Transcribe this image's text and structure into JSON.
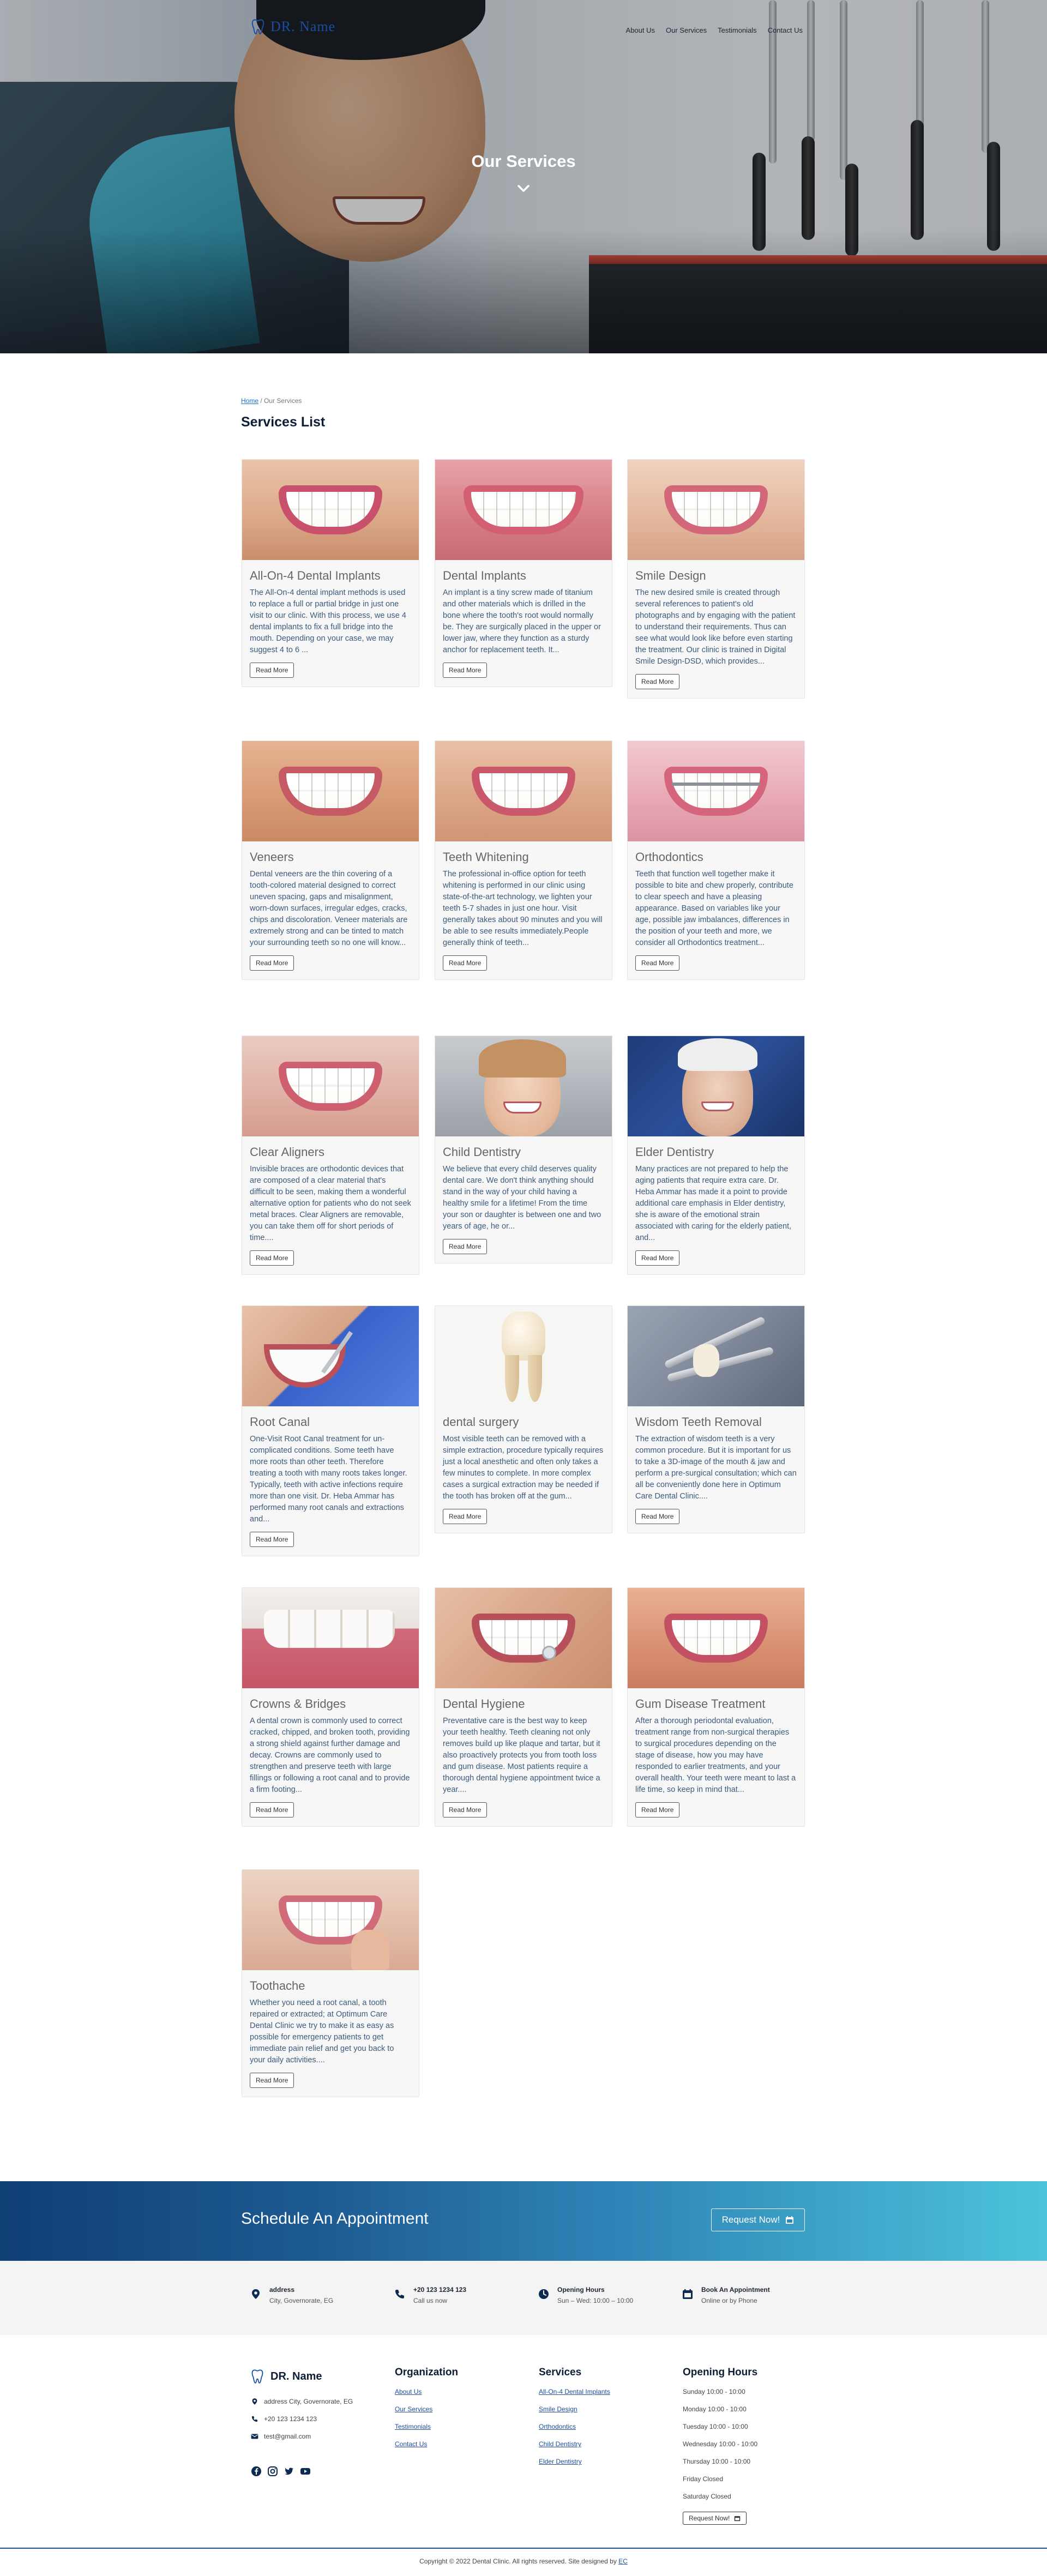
{
  "brand": {
    "name": "DR. Name"
  },
  "nav": {
    "items": [
      "About Us",
      "Our Services",
      "Testimonials",
      "Contact Us"
    ]
  },
  "hero": {
    "title": "Our Services"
  },
  "breadcrumb": {
    "home": "Home",
    "separator": "/",
    "current": "Our Services"
  },
  "section_title": "Services List",
  "read_more": "Read More",
  "services": [
    {
      "title": "All-On-4 Dental Implants",
      "text": "The All-On-4 dental implant methods is used to replace a full or partial bridge in just one visit to our clinic. With this process, we use 4 dental implants to fix a full bridge into the mouth. Depending on your case, we may suggest 4 to 6 ..."
    },
    {
      "title": "Dental Implants",
      "text": "An implant is a tiny screw made of titanium and other materials which is drilled in the bone where the tooth's root would normally be. They are surgically placed in the upper or lower jaw, where they function as a sturdy anchor for replacement teeth. It..."
    },
    {
      "title": "Smile Design",
      "text": "The new desired smile is created through several references to patient's old photographs and by engaging with the patient to understand their requirements. Thus can see what would look like before even starting the treatment. Our clinic is trained in Digital Smile Design-DSD, which provides..."
    },
    {
      "title": "Veneers",
      "text": "Dental veneers are the thin covering of a tooth-colored material designed to correct uneven spacing, gaps and misalignment, worn-down surfaces, irregular edges, cracks, chips and discoloration. Veneer materials are extremely strong and can be tinted to match your surrounding teeth so no one will know..."
    },
    {
      "title": "Teeth Whitening",
      "text": "The professional in-office option for teeth whitening is performed in our clinic using state-of-the-art technology, we lighten your teeth 5-7 shades in just one hour. Visit generally takes about 90 minutes and you will be able to see results immediately.People generally think of teeth..."
    },
    {
      "title": "Orthodontics",
      "text": "Teeth that function well together make it possible to bite and chew properly, contribute to clear speech and have a pleasing appearance. Based on variables like your age, possible jaw imbalances, differences in the position of your teeth and more, we consider all Orthodontics treatment..."
    },
    {
      "title": "Clear Aligners",
      "text": "Invisible braces are orthodontic devices that are composed of a clear material that's difficult to be seen, making them a wonderful alternative option for patients who do not seek metal braces. Clear Aligners are removable, you can take them off for short periods of time...."
    },
    {
      "title": "Child Dentistry",
      "text": "We believe that every child deserves quality dental care. We don't think anything should stand in the way of your child having a healthy smile for a lifetime! From the time your son or daughter is between one and two years of age, he or..."
    },
    {
      "title": "Elder Dentistry",
      "text": "Many practices are not prepared to help the aging patients that require extra care. Dr. Heba Ammar has made it a point to provide additional care emphasis in Elder dentistry, she is aware of the emotional strain associated with caring for the elderly patient, and..."
    },
    {
      "title": "Root Canal",
      "text": "One-Visit Root Canal treatment for un-complicated conditions. Some teeth have more roots than other teeth. Therefore treating a tooth with many roots takes longer. Typically, teeth with active infections require more than one visit. Dr. Heba Ammar has performed many root canals and extractions and..."
    },
    {
      "title": "dental surgery",
      "text": "Most visible teeth can be removed with a simple extraction, procedure typically requires just a local anesthetic and often only takes a few minutes to complete. In more complex cases a surgical extraction may be needed if the tooth has broken off at the gum..."
    },
    {
      "title": "Wisdom Teeth Removal",
      "text": "The extraction of wisdom teeth is a very common procedure. But it is important for us to take a 3D-image of the mouth & jaw and perform a pre-surgical consultation; which can all be conveniently done here in Optimum Care Dental Clinic...."
    },
    {
      "title": "Crowns & Bridges",
      "text": "A dental crown is commonly used to correct cracked, chipped, and broken tooth, providing a strong shield against further damage and decay. Crowns are commonly used to strengthen and preserve teeth with large fillings or following a root canal and to provide a firm footing..."
    },
    {
      "title": "Dental Hygiene",
      "text": "Preventative care is the best way to keep your teeth healthy. Teeth cleaning not only removes build up like plaque and tartar, but it also proactively protects you from tooth loss and gum disease. Most patients require a thorough dental hygiene appointment twice a year...."
    },
    {
      "title": "Gum Disease Treatment",
      "text": "After a thorough periodontal evaluation, treatment range from non-surgical therapies to surgical procedures depending on the stage of disease, how you may have responded to earlier treatments, and your overall health. Your teeth were meant to last a life time, so keep in mind that..."
    },
    {
      "title": "Toothache",
      "text": "Whether you need a root canal, a tooth repaired or extracted; at Optimum Care Dental Clinic we try to make it as easy as possible for emergency patients to get immediate pain relief and get you back to your daily activities...."
    }
  ],
  "appointment": {
    "title": "Schedule An Appointment",
    "button": "Request Now!"
  },
  "info": [
    {
      "label": "address",
      "value": "City, Governorate, EG"
    },
    {
      "label": "+20 123 1234 123",
      "value": "Call us now"
    },
    {
      "label": "Opening Hours",
      "value": "Sun – Wed: 10:00 – 10:00"
    },
    {
      "label": "Book An Appointment",
      "value": "Online or by Phone"
    }
  ],
  "footer": {
    "brand": "DR. Name",
    "contact": [
      "address City, Governorate, EG",
      "+20 123 1234 123",
      "test@gmail.com"
    ],
    "organization": {
      "title": "Organization",
      "links": [
        "About Us",
        "Our Services",
        "Testimonials",
        "Contact Us"
      ]
    },
    "services": {
      "title": "Services",
      "links": [
        "All-On-4 Dental Implants",
        "Smile Design",
        "Orthodontics",
        "Child Dentistry",
        "Elder Dentistry"
      ]
    },
    "hours": {
      "title": "Opening Hours",
      "lines": [
        "Sunday 10:00 - 10:00",
        "Monday 10:00 - 10:00",
        "Tuesday 10:00 - 10:00",
        "Wednesday 10:00 - 10:00",
        "Thursday 10:00 - 10:00",
        "Friday Closed",
        "Saturday Closed"
      ],
      "button": "Request Now!"
    },
    "copyright": "Copyright © 2022 Dental Clinic. All rights reserved. Site designed by",
    "designer": "EC"
  },
  "colors": {
    "brand_blue": "#1b4ea0",
    "navy": "#0d1e36",
    "link_blue": "#1d4f9c",
    "body_text": "#3b5a7c"
  },
  "icons": [
    "tooth-icon",
    "chevron-down-icon",
    "calendar-icon",
    "location-icon",
    "phone-icon",
    "clock-icon",
    "mail-icon",
    "facebook-icon",
    "instagram-icon",
    "twitter-icon",
    "youtube-icon"
  ]
}
